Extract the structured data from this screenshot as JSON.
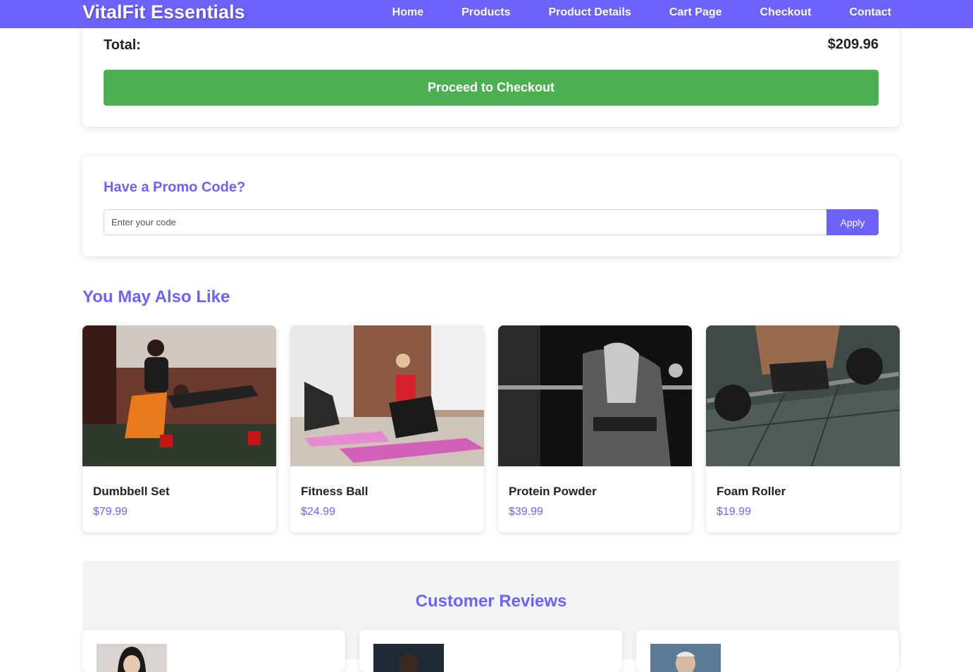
{
  "nav": {
    "brand": "VitalFit Essentials",
    "links": [
      "Home",
      "Products",
      "Product Details",
      "Cart Page",
      "Checkout",
      "Contact"
    ]
  },
  "summary": {
    "total_label": "Total:",
    "total_value": "$209.96",
    "checkout_label": "Proceed to Checkout"
  },
  "promo": {
    "title": "Have a Promo Code?",
    "placeholder": "Enter your code",
    "apply_label": "Apply"
  },
  "related": {
    "title": "You May Also Like",
    "products": [
      {
        "name": "Dumbbell Set",
        "price": "$79.99"
      },
      {
        "name": "Fitness Ball",
        "price": "$24.99"
      },
      {
        "name": "Protein Powder",
        "price": "$39.99"
      },
      {
        "name": "Foam Roller",
        "price": "$19.99"
      }
    ]
  },
  "reviews": {
    "title": "Customer Reviews"
  },
  "colors": {
    "accent": "#6c63ff",
    "checkout": "#4caf50",
    "price": "#6c63ff"
  }
}
